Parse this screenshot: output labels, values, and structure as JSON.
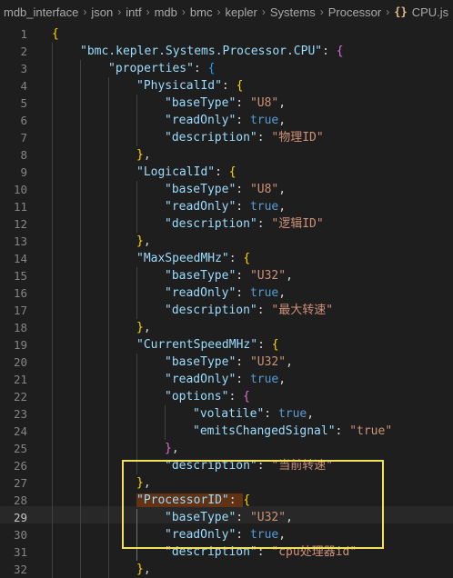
{
  "breadcrumb": [
    "mdb_interface",
    "json",
    "intf",
    "mdb",
    "bmc",
    "kepler",
    "Systems",
    "Processor"
  ],
  "breadcrumb_file_icon": "{}",
  "breadcrumb_file": "CPU.js",
  "active_line": 29,
  "lines": [
    {
      "n": 1,
      "tokens": [
        [
          "br1",
          "{"
        ]
      ]
    },
    {
      "n": 2,
      "tokens": [
        [
          "sp",
          ""
        ],
        [
          "k",
          "\"bmc.kepler.Systems.Processor.CPU\""
        ],
        [
          "p",
          ": "
        ],
        [
          "br2",
          "{"
        ]
      ]
    },
    {
      "n": 3,
      "tokens": [
        [
          "sp",
          ""
        ],
        [
          "sp",
          ""
        ],
        [
          "k",
          "\"properties\""
        ],
        [
          "p",
          ": "
        ],
        [
          "br3",
          "{"
        ]
      ]
    },
    {
      "n": 4,
      "tokens": [
        [
          "sp",
          ""
        ],
        [
          "sp",
          ""
        ],
        [
          "sp",
          ""
        ],
        [
          "k",
          "\"PhysicalId\""
        ],
        [
          "p",
          ": "
        ],
        [
          "br1",
          "{"
        ]
      ]
    },
    {
      "n": 5,
      "tokens": [
        [
          "sp",
          ""
        ],
        [
          "sp",
          ""
        ],
        [
          "sp",
          ""
        ],
        [
          "sp",
          ""
        ],
        [
          "k",
          "\"baseType\""
        ],
        [
          "p",
          ": "
        ],
        [
          "s",
          "\"U8\""
        ],
        [
          "p",
          ","
        ]
      ]
    },
    {
      "n": 6,
      "tokens": [
        [
          "sp",
          ""
        ],
        [
          "sp",
          ""
        ],
        [
          "sp",
          ""
        ],
        [
          "sp",
          ""
        ],
        [
          "k",
          "\"readOnly\""
        ],
        [
          "p",
          ": "
        ],
        [
          "b",
          "true"
        ],
        [
          "p",
          ","
        ]
      ]
    },
    {
      "n": 7,
      "tokens": [
        [
          "sp",
          ""
        ],
        [
          "sp",
          ""
        ],
        [
          "sp",
          ""
        ],
        [
          "sp",
          ""
        ],
        [
          "k",
          "\"description\""
        ],
        [
          "p",
          ": "
        ],
        [
          "s",
          "\"物理ID\""
        ]
      ]
    },
    {
      "n": 8,
      "tokens": [
        [
          "sp",
          ""
        ],
        [
          "sp",
          ""
        ],
        [
          "sp",
          ""
        ],
        [
          "br1",
          "}"
        ],
        [
          "p",
          ","
        ]
      ]
    },
    {
      "n": 9,
      "tokens": [
        [
          "sp",
          ""
        ],
        [
          "sp",
          ""
        ],
        [
          "sp",
          ""
        ],
        [
          "k",
          "\"LogicalId\""
        ],
        [
          "p",
          ": "
        ],
        [
          "br1",
          "{"
        ]
      ]
    },
    {
      "n": 10,
      "tokens": [
        [
          "sp",
          ""
        ],
        [
          "sp",
          ""
        ],
        [
          "sp",
          ""
        ],
        [
          "sp",
          ""
        ],
        [
          "k",
          "\"baseType\""
        ],
        [
          "p",
          ": "
        ],
        [
          "s",
          "\"U8\""
        ],
        [
          "p",
          ","
        ]
      ]
    },
    {
      "n": 11,
      "tokens": [
        [
          "sp",
          ""
        ],
        [
          "sp",
          ""
        ],
        [
          "sp",
          ""
        ],
        [
          "sp",
          ""
        ],
        [
          "k",
          "\"readOnly\""
        ],
        [
          "p",
          ": "
        ],
        [
          "b",
          "true"
        ],
        [
          "p",
          ","
        ]
      ]
    },
    {
      "n": 12,
      "tokens": [
        [
          "sp",
          ""
        ],
        [
          "sp",
          ""
        ],
        [
          "sp",
          ""
        ],
        [
          "sp",
          ""
        ],
        [
          "k",
          "\"description\""
        ],
        [
          "p",
          ": "
        ],
        [
          "s",
          "\"逻辑ID\""
        ]
      ]
    },
    {
      "n": 13,
      "tokens": [
        [
          "sp",
          ""
        ],
        [
          "sp",
          ""
        ],
        [
          "sp",
          ""
        ],
        [
          "br1",
          "}"
        ],
        [
          "p",
          ","
        ]
      ]
    },
    {
      "n": 14,
      "tokens": [
        [
          "sp",
          ""
        ],
        [
          "sp",
          ""
        ],
        [
          "sp",
          ""
        ],
        [
          "k",
          "\"MaxSpeedMHz\""
        ],
        [
          "p",
          ": "
        ],
        [
          "br1",
          "{"
        ]
      ]
    },
    {
      "n": 15,
      "tokens": [
        [
          "sp",
          ""
        ],
        [
          "sp",
          ""
        ],
        [
          "sp",
          ""
        ],
        [
          "sp",
          ""
        ],
        [
          "k",
          "\"baseType\""
        ],
        [
          "p",
          ": "
        ],
        [
          "s",
          "\"U32\""
        ],
        [
          "p",
          ","
        ]
      ]
    },
    {
      "n": 16,
      "tokens": [
        [
          "sp",
          ""
        ],
        [
          "sp",
          ""
        ],
        [
          "sp",
          ""
        ],
        [
          "sp",
          ""
        ],
        [
          "k",
          "\"readOnly\""
        ],
        [
          "p",
          ": "
        ],
        [
          "b",
          "true"
        ],
        [
          "p",
          ","
        ]
      ]
    },
    {
      "n": 17,
      "tokens": [
        [
          "sp",
          ""
        ],
        [
          "sp",
          ""
        ],
        [
          "sp",
          ""
        ],
        [
          "sp",
          ""
        ],
        [
          "k",
          "\"description\""
        ],
        [
          "p",
          ": "
        ],
        [
          "s",
          "\"最大转速\""
        ]
      ]
    },
    {
      "n": 18,
      "tokens": [
        [
          "sp",
          ""
        ],
        [
          "sp",
          ""
        ],
        [
          "sp",
          ""
        ],
        [
          "br1",
          "}"
        ],
        [
          "p",
          ","
        ]
      ]
    },
    {
      "n": 19,
      "tokens": [
        [
          "sp",
          ""
        ],
        [
          "sp",
          ""
        ],
        [
          "sp",
          ""
        ],
        [
          "k",
          "\"CurrentSpeedMHz\""
        ],
        [
          "p",
          ": "
        ],
        [
          "br1",
          "{"
        ]
      ]
    },
    {
      "n": 20,
      "tokens": [
        [
          "sp",
          ""
        ],
        [
          "sp",
          ""
        ],
        [
          "sp",
          ""
        ],
        [
          "sp",
          ""
        ],
        [
          "k",
          "\"baseType\""
        ],
        [
          "p",
          ": "
        ],
        [
          "s",
          "\"U32\""
        ],
        [
          "p",
          ","
        ]
      ]
    },
    {
      "n": 21,
      "tokens": [
        [
          "sp",
          ""
        ],
        [
          "sp",
          ""
        ],
        [
          "sp",
          ""
        ],
        [
          "sp",
          ""
        ],
        [
          "k",
          "\"readOnly\""
        ],
        [
          "p",
          ": "
        ],
        [
          "b",
          "true"
        ],
        [
          "p",
          ","
        ]
      ]
    },
    {
      "n": 22,
      "tokens": [
        [
          "sp",
          ""
        ],
        [
          "sp",
          ""
        ],
        [
          "sp",
          ""
        ],
        [
          "sp",
          ""
        ],
        [
          "k",
          "\"options\""
        ],
        [
          "p",
          ": "
        ],
        [
          "br2",
          "{"
        ]
      ]
    },
    {
      "n": 23,
      "tokens": [
        [
          "sp",
          ""
        ],
        [
          "sp",
          ""
        ],
        [
          "sp",
          ""
        ],
        [
          "sp",
          ""
        ],
        [
          "sp",
          ""
        ],
        [
          "k",
          "\"volatile\""
        ],
        [
          "p",
          ": "
        ],
        [
          "b",
          "true"
        ],
        [
          "p",
          ","
        ]
      ]
    },
    {
      "n": 24,
      "tokens": [
        [
          "sp",
          ""
        ],
        [
          "sp",
          ""
        ],
        [
          "sp",
          ""
        ],
        [
          "sp",
          ""
        ],
        [
          "sp",
          ""
        ],
        [
          "k",
          "\"emitsChangedSignal\""
        ],
        [
          "p",
          ": "
        ],
        [
          "s",
          "\"true\""
        ]
      ]
    },
    {
      "n": 25,
      "tokens": [
        [
          "sp",
          ""
        ],
        [
          "sp",
          ""
        ],
        [
          "sp",
          ""
        ],
        [
          "sp",
          ""
        ],
        [
          "br2",
          "}"
        ],
        [
          "p",
          ","
        ]
      ]
    },
    {
      "n": 26,
      "tokens": [
        [
          "sp",
          ""
        ],
        [
          "sp",
          ""
        ],
        [
          "sp",
          ""
        ],
        [
          "sp",
          ""
        ],
        [
          "k",
          "\"description\""
        ],
        [
          "p",
          ": "
        ],
        [
          "s",
          "\"当前转速\""
        ]
      ]
    },
    {
      "n": 27,
      "tokens": [
        [
          "sp",
          ""
        ],
        [
          "sp",
          ""
        ],
        [
          "sp",
          ""
        ],
        [
          "br1",
          "}"
        ],
        [
          "p",
          ","
        ]
      ]
    },
    {
      "n": 28,
      "tokens": [
        [
          "sp",
          ""
        ],
        [
          "sp",
          ""
        ],
        [
          "sp",
          ""
        ],
        [
          "khl",
          "\"ProcessorID\""
        ],
        [
          "phl",
          ": "
        ],
        [
          "br1",
          "{"
        ]
      ]
    },
    {
      "n": 29,
      "tokens": [
        [
          "sp",
          ""
        ],
        [
          "sp",
          ""
        ],
        [
          "sp",
          ""
        ],
        [
          "sp",
          ""
        ],
        [
          "k",
          "\"baseType\""
        ],
        [
          "p",
          ": "
        ],
        [
          "s",
          "\"U32\""
        ],
        [
          "p",
          ","
        ]
      ]
    },
    {
      "n": 30,
      "tokens": [
        [
          "sp",
          ""
        ],
        [
          "sp",
          ""
        ],
        [
          "sp",
          ""
        ],
        [
          "sp",
          ""
        ],
        [
          "k",
          "\"readOnly\""
        ],
        [
          "p",
          ": "
        ],
        [
          "b",
          "true"
        ],
        [
          "p",
          ","
        ]
      ]
    },
    {
      "n": 31,
      "tokens": [
        [
          "sp",
          ""
        ],
        [
          "sp",
          ""
        ],
        [
          "sp",
          ""
        ],
        [
          "sp",
          ""
        ],
        [
          "k",
          "\"description\""
        ],
        [
          "p",
          ": "
        ],
        [
          "s",
          "\"cpu处理器id\""
        ]
      ]
    },
    {
      "n": 32,
      "tokens": [
        [
          "sp",
          ""
        ],
        [
          "sp",
          ""
        ],
        [
          "sp",
          ""
        ],
        [
          "br1",
          "}"
        ],
        [
          "p",
          ","
        ]
      ]
    }
  ]
}
